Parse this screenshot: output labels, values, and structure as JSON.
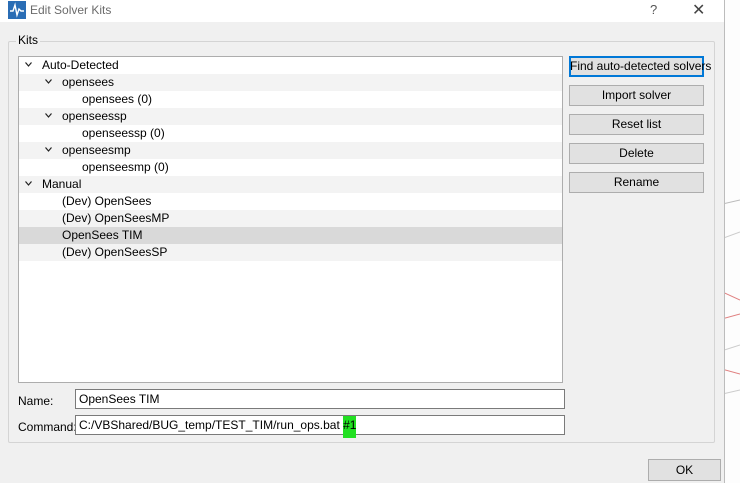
{
  "window": {
    "title": "Edit Solver Kits",
    "help_glyph": "?",
    "close_glyph": "✕",
    "icon": "app-icon"
  },
  "group": {
    "title": "Kits"
  },
  "tree": {
    "auto_detected": {
      "label": "Auto-Detected",
      "children": [
        {
          "label": "opensees",
          "child": "opensees (0)"
        },
        {
          "label": "openseessp",
          "child": "openseessp (0)"
        },
        {
          "label": "openseesmp",
          "child": "openseesmp (0)"
        }
      ]
    },
    "manual": {
      "label": "Manual",
      "items": [
        "(Dev) OpenSees",
        "(Dev) OpenSeesMP",
        "OpenSees TIM",
        "(Dev) OpenSeesSP"
      ],
      "selected_index": 2
    }
  },
  "buttons": {
    "find": "Find auto-detected solvers",
    "import": "Import solver",
    "reset": "Reset list",
    "delete": "Delete",
    "rename": "Rename",
    "ok": "OK"
  },
  "form": {
    "name_label": "Name:",
    "name_value": "OpenSees TIM",
    "command_label": "Command:",
    "command_value": "C:/VBShared/BUG_temp/TEST_TIM/run_ops.bat ",
    "command_highlight": "#1"
  },
  "colors": {
    "selection": "#d9d9d9",
    "highlight": "#22e022",
    "default_button_border": "#0078d7"
  }
}
